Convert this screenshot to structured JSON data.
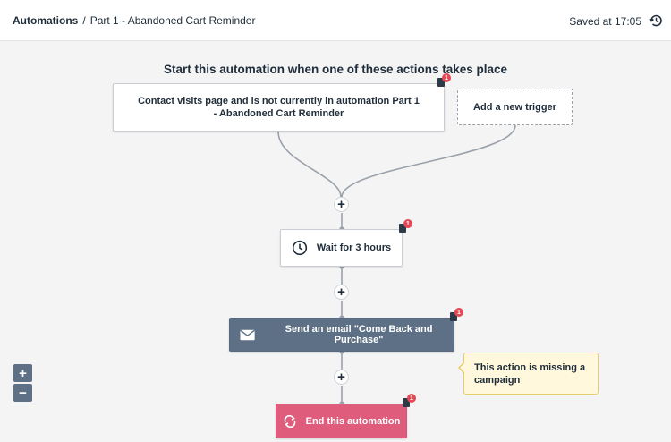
{
  "header": {
    "breadcrumb_root": "Automations",
    "breadcrumb_separator": "/",
    "breadcrumb_page": "Part 1 - Abandoned Cart Reminder",
    "saved_status": "Saved at 17:05",
    "history_icon": "history-icon"
  },
  "canvas": {
    "title": "Start this automation when one of these actions takes place",
    "trigger": {
      "label": "Contact visits page and is not currently in automation Part 1 - Abandoned Cart Reminder",
      "note_count": "1"
    },
    "add_trigger_label": "Add a new trigger",
    "steps": {
      "wait": {
        "label": "Wait for 3 hours",
        "icon": "clock-icon",
        "note_count": "1"
      },
      "email": {
        "label": "Send an email \"Come Back and Purchase\"",
        "icon": "envelope-icon",
        "note_count": "1"
      },
      "end": {
        "label": "End this automation",
        "icon": "restart-icon",
        "note_count": "1"
      }
    },
    "add_step_symbol": "+",
    "warning": "This action is missing a campaign"
  },
  "zoom": {
    "in_symbol": "+",
    "out_symbol": "−"
  },
  "colors": {
    "email_node": "#5d7086",
    "end_node": "#e05c7c",
    "badge_red": "#e54853",
    "warning_bg": "#fff8dc",
    "warning_border": "#e9c96a"
  }
}
